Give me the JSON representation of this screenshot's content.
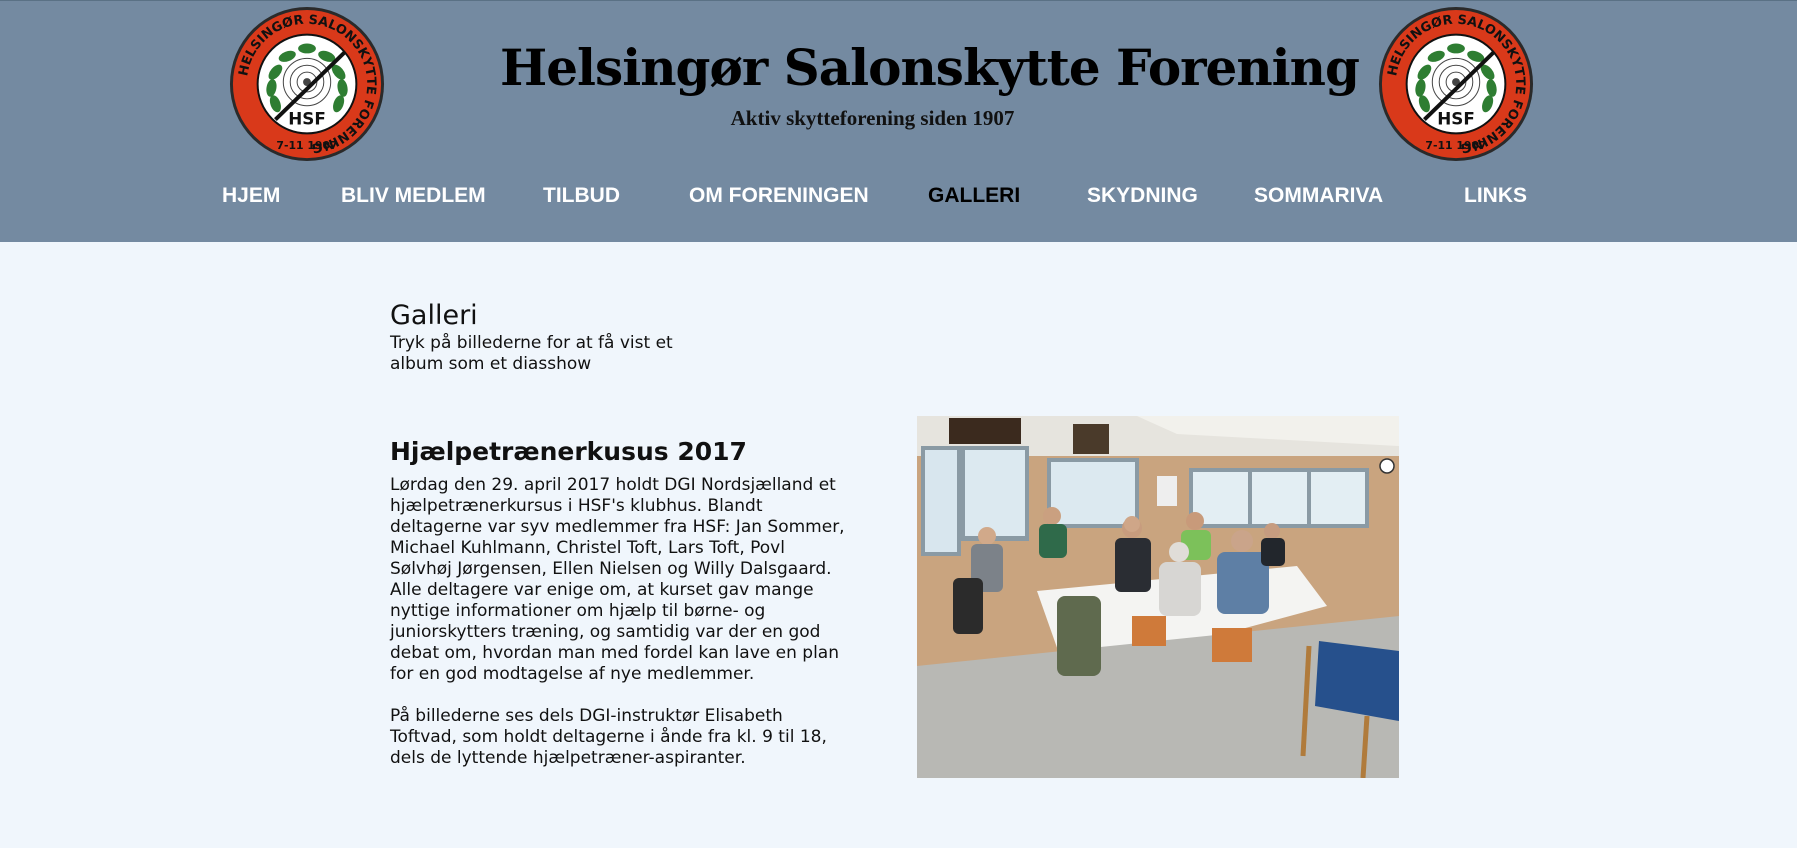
{
  "site": {
    "title": "Helsingør Salonskytte Forening",
    "tagline": "Aktiv skytteforening siden 1907",
    "logo": {
      "ring_text": "HELSINGØR SALONSKYTTE FORENING",
      "abbrev": "HSF",
      "date": "7-11  1907",
      "colors": {
        "ring": "#d9391a",
        "inner": "#ffffff",
        "laurel": "#2e7d32"
      }
    }
  },
  "nav": {
    "items": [
      {
        "label": "HJEM",
        "active": false
      },
      {
        "label": "BLIV MEDLEM",
        "active": false
      },
      {
        "label": "TILBUD",
        "active": false
      },
      {
        "label": "OM FORENINGEN",
        "active": false
      },
      {
        "label": "GALLERI",
        "active": true
      },
      {
        "label": "SKYDNING",
        "active": false
      },
      {
        "label": "SOMMARIVA",
        "active": false
      },
      {
        "label": "LINKS",
        "active": false
      }
    ]
  },
  "page": {
    "heading": "Galleri",
    "intro_lines": [
      "Tryk på billederne for at få vist et",
      "album som et diasshow"
    ]
  },
  "article": {
    "title": "Hjælpetrænerkusus 2017",
    "paragraph1_lines": [
      "Lørdag den 29. april 2017 holdt DGI Nordsjælland et",
      "hjælpetrænerkursus i HSF's klubhus. Blandt",
      "deltagerne var syv medlemmer fra HSF: Jan Sommer,",
      "Michael Kuhlmann, Christel Toft, Lars Toft, Povl",
      "Sølvhøj Jørgensen, Ellen Nielsen og Willy Dalsgaard.",
      "Alle deltagere var enige om, at kurset gav mange",
      "nyttige informationer om hjælp til børne- og",
      "juniorskytters træning, og samtidig var der en god",
      "debat om, hvordan man med fordel kan lave en plan",
      "for en god modtagelse af nye medlemmer."
    ],
    "paragraph2_lines": [
      "På billederne ses dels DGI-instruktør Elisabeth",
      "Toftvad, som holdt deltagerne i ånde fra kl. 9 til 18,",
      "dels  de lyttende hjælpetræner-aspiranter."
    ]
  },
  "colors": {
    "header_bg": "#748aa1",
    "page_bg": "#f0f6fc",
    "nav_text": "#ffffff",
    "nav_active": "#000000"
  }
}
